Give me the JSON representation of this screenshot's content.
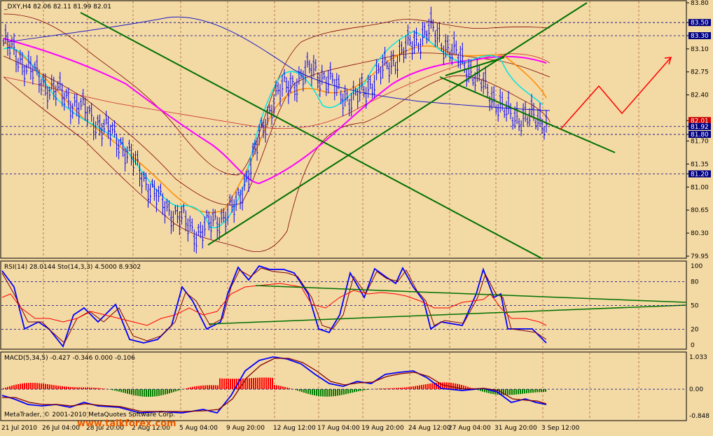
{
  "colors": {
    "background": "#f3d9a4",
    "price": "#0000ff",
    "ma_fast": "#00e6e6",
    "ma_mid": "#ff8c00",
    "ma_slow": "#ff00ff",
    "ma_long": "#1c1cc8",
    "ma_200": "#cc2a2a",
    "bands": "#800000",
    "trend": "#007000",
    "forecast": "#ff0000",
    "grid": "#a05020",
    "hline": "#000080",
    "hist_pos": "#ff0000",
    "hist_neg": "#008000",
    "watermark": "#e85a00"
  },
  "main_panel": {
    "header": "_DXY,H4 82.06 82.11 81.99 82.01",
    "price_scale": [
      "83.80",
      "83.50",
      "83.30",
      "83.10",
      "82.75",
      "82.40",
      "82.01",
      "81.92",
      "81.80",
      "81.70",
      "81.35",
      "81.20",
      "81.00",
      "80.65",
      "80.30",
      "79.95"
    ],
    "highlighted_prices": [
      "83.50",
      "83.30",
      "82.01",
      "81.92",
      "81.80",
      "81.20"
    ]
  },
  "rsi_panel": {
    "header": "RSI(14) 28.0144  Sto(14,3,3) 4.5000  8.9302",
    "scale": [
      "100",
      "80",
      "50",
      "20",
      "0"
    ]
  },
  "macd_panel": {
    "header": "MACD(5,34,5) -0.427 -0.346 0.000 -0.106",
    "scale": [
      "1.033",
      "0.00",
      "-0.848"
    ]
  },
  "time_axis": [
    "21 Jul 2010",
    "26 Jul 04:00",
    "28 Jul 20:00",
    "2 Aug 12:00",
    "5 Aug 04:00",
    "9 Aug 20:00",
    "12 Aug 12:00",
    "17 Aug 04:00",
    "19 Aug 20:00",
    "24 Aug 12:00",
    "27 Aug 04:00",
    "31 Aug 20:00",
    "3 Sep 12:00"
  ],
  "copyright": "MetaTrader, © 2001-2010 MetaQuotes Software Corp.",
  "watermark": "www.talkforex.com",
  "chart_data": {
    "type": "line",
    "title": "_DXY,H4",
    "x": [
      "21 Jul 2010",
      "26 Jul 04:00",
      "28 Jul 20:00",
      "2 Aug 12:00",
      "5 Aug 04:00",
      "9 Aug 20:00",
      "12 Aug 12:00",
      "17 Aug 04:00",
      "19 Aug 20:00",
      "24 Aug 12:00",
      "27 Aug 04:00",
      "31 Aug 20:00",
      "3 Sep 12:00"
    ],
    "ylim": [
      79.95,
      83.8
    ],
    "series": [
      {
        "values": [
          83.2,
          82.6,
          82.2,
          81.7,
          80.8,
          80.3,
          80.7,
          82.4,
          82.8,
          82.3,
          82.9,
          83.4,
          82.8,
          82.1,
          82.01
        ]
      }
    ],
    "ohlc_last": {
      "open": 82.06,
      "high": 82.11,
      "low": 81.99,
      "close": 82.01
    },
    "rsi": {
      "period": 14,
      "value": 28.0144
    },
    "stochastic": {
      "params": "14,3,3",
      "k": 4.5,
      "d": 8.9302
    },
    "macd": {
      "params": "5,34,5",
      "values": [
        -0.427,
        -0.346,
        0.0,
        -0.106
      ]
    },
    "grid": true
  }
}
